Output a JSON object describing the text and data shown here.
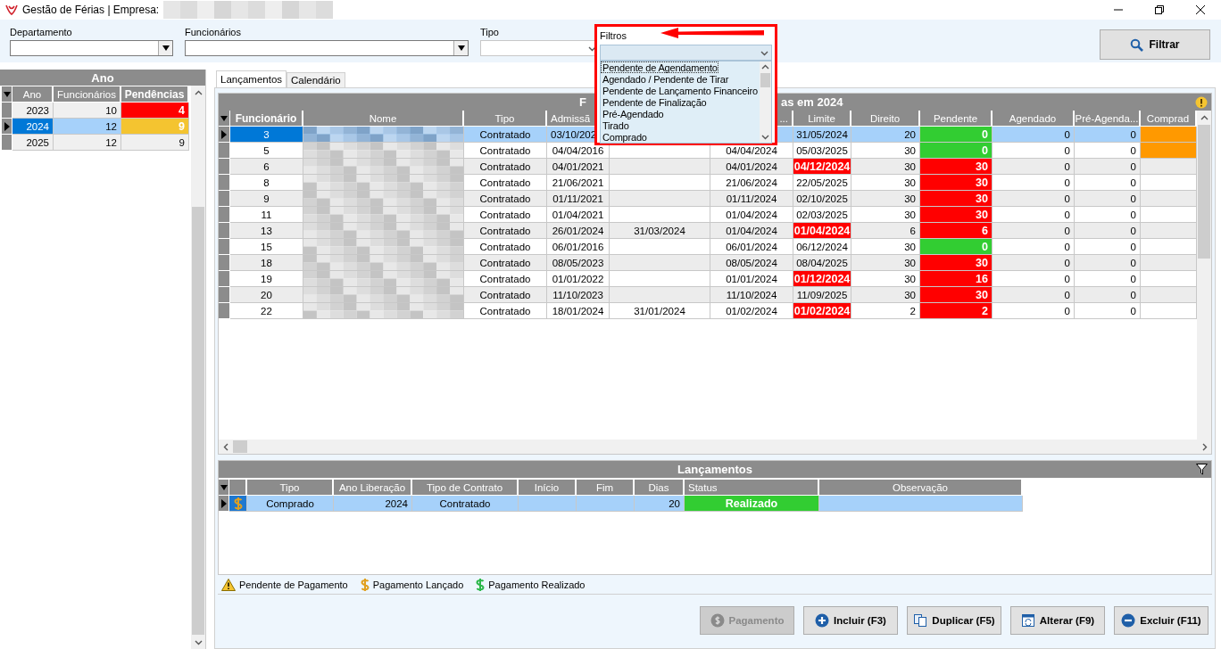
{
  "window": {
    "title": "Gestão de Férias | Empresa:"
  },
  "filters": [
    {
      "label": "Departamento",
      "kind": "combo",
      "disabled": false
    },
    {
      "label": "Funcionários",
      "kind": "combo",
      "disabled": false
    },
    {
      "label": "Tipo",
      "kind": "combo",
      "disabled": true
    }
  ],
  "filter_dropdown": {
    "label": "Filtros",
    "options": [
      {
        "label": "Pendente de Agendamento",
        "selected": true
      },
      {
        "label": "Agendado / Pendente de Tirar",
        "selected": false
      },
      {
        "label": "Pendente de Lançamento Financeiro",
        "selected": false
      },
      {
        "label": "Pendente de Finalização",
        "selected": false
      },
      {
        "label": "Pré-Agendado",
        "selected": false
      },
      {
        "label": "Tirado",
        "selected": false
      },
      {
        "label": "Comprado",
        "selected": false
      }
    ]
  },
  "filter_button": "Filtrar",
  "year_panel": {
    "title": "Ano",
    "columns": [
      "Ano",
      "Funcionários",
      "Pendências"
    ],
    "rows": [
      {
        "ano": "2023",
        "funcionarios": "10",
        "pendencias": "4",
        "color": "#ff0000",
        "selected": false
      },
      {
        "ano": "2024",
        "funcionarios": "12",
        "pendencias": "9",
        "color": "#f4c430",
        "selected": true
      },
      {
        "ano": "2025",
        "funcionarios": "12",
        "pendencias": "9",
        "selected": false
      }
    ]
  },
  "tabs": [
    {
      "label": "Lançamentos",
      "selected": true
    },
    {
      "label": "Calendário",
      "selected": false
    }
  ],
  "employees_grid": {
    "title_start": "F",
    "title_end": "as em 2024",
    "columns": [
      "Funcionário",
      "Nome",
      "Tipo",
      "Admissã",
      "...",
      "Limite",
      "Direito",
      "Pendente",
      "Agendado",
      "Pré-Agenda...",
      "Comprad"
    ],
    "rows": [
      {
        "funcionario": "3",
        "tipo": "Contratado",
        "admissao": "03/10/202",
        "limite": "31/05/2024",
        "limite_late": false,
        "direito": "20",
        "pendente": "0",
        "pendente_late": false,
        "agendado": "0",
        "pre_agendado": "0",
        "comprado_marked": true,
        "selected": true
      },
      {
        "funcionario": "5",
        "tipo": "Contratado",
        "admissao": "04/04/2016",
        "column_7": "04/04/2024",
        "limite": "05/03/2025",
        "limite_late": false,
        "direito": "30",
        "pendente": "0",
        "pendente_late": false,
        "agendado": "0",
        "pre_agendado": "0",
        "comprado_marked": true,
        "selected": false
      },
      {
        "funcionario": "6",
        "tipo": "Contratado",
        "admissao": "04/01/2021",
        "column_7": "04/01/2024",
        "limite": "04/12/2024",
        "limite_late": true,
        "direito": "30",
        "pendente": "30",
        "pendente_late": true,
        "agendado": "0",
        "pre_agendado": "0",
        "comprado_marked": false,
        "selected": false
      },
      {
        "funcionario": "8",
        "tipo": "Contratado",
        "admissao": "21/06/2021",
        "column_7": "21/06/2024",
        "limite": "22/05/2025",
        "limite_late": false,
        "direito": "30",
        "pendente": "30",
        "pendente_late": true,
        "agendado": "0",
        "pre_agendado": "0",
        "comprado_marked": false,
        "selected": false
      },
      {
        "funcionario": "9",
        "tipo": "Contratado",
        "admissao": "01/11/2021",
        "column_7": "01/11/2024",
        "limite": "02/10/2025",
        "limite_late": false,
        "direito": "30",
        "pendente": "30",
        "pendente_late": true,
        "agendado": "0",
        "pre_agendado": "0",
        "comprado_marked": false,
        "selected": false
      },
      {
        "funcionario": "11",
        "tipo": "Contratado",
        "admissao": "01/04/2021",
        "column_7": "01/04/2024",
        "limite": "02/03/2025",
        "limite_late": false,
        "direito": "30",
        "pendente": "30",
        "pendente_late": true,
        "agendado": "0",
        "pre_agendado": "0",
        "comprado_marked": false,
        "selected": false
      },
      {
        "funcionario": "13",
        "tipo": "Contratado",
        "admissao": "26/01/2024",
        "column_6": "31/03/2024",
        "column_7": "01/04/2024",
        "limite": "01/04/2024",
        "limite_late": true,
        "direito": "6",
        "pendente": "6",
        "pendente_late": true,
        "agendado": "0",
        "pre_agendado": "0",
        "comprado_marked": false,
        "selected": false
      },
      {
        "funcionario": "15",
        "tipo": "Contratado",
        "admissao": "06/01/2016",
        "column_7": "06/01/2024",
        "limite": "06/12/2024",
        "limite_late": false,
        "direito": "30",
        "pendente": "0",
        "pendente_late": false,
        "agendado": "0",
        "pre_agendado": "0",
        "comprado_marked": false,
        "selected": false
      },
      {
        "funcionario": "18",
        "tipo": "Contratado",
        "admissao": "08/05/2023",
        "column_7": "08/05/2024",
        "limite": "08/04/2025",
        "limite_late": false,
        "direito": "30",
        "pendente": "30",
        "pendente_late": true,
        "agendado": "0",
        "pre_agendado": "0",
        "comprado_marked": false,
        "selected": false
      },
      {
        "funcionario": "19",
        "tipo": "Contratado",
        "admissao": "01/01/2022",
        "column_7": "01/01/2024",
        "limite": "01/12/2024",
        "limite_late": true,
        "direito": "30",
        "pendente": "16",
        "pendente_late": true,
        "agendado": "0",
        "pre_agendado": "0",
        "comprado_marked": false,
        "selected": false
      },
      {
        "funcionario": "20",
        "tipo": "Contratado",
        "admissao": "11/10/2023",
        "column_7": "11/10/2024",
        "limite": "11/09/2025",
        "limite_late": false,
        "direito": "30",
        "pendente": "30",
        "pendente_late": true,
        "agendado": "0",
        "pre_agendado": "0",
        "comprado_marked": false,
        "selected": false
      },
      {
        "funcionario": "22",
        "tipo": "Contratado",
        "admissao": "18/01/2024",
        "column_6": "31/01/2024",
        "column_7": "01/02/2024",
        "limite": "01/02/2024",
        "limite_late": true,
        "direito": "2",
        "pendente": "2",
        "pendente_late": true,
        "agendado": "0",
        "pre_agendado": "0",
        "comprado_marked": false,
        "selected": false
      }
    ]
  },
  "entries_grid": {
    "title": "Lançamentos",
    "columns": [
      "Tipo",
      "Ano Liberação",
      "Tipo de Contrato",
      "Início",
      "Fim",
      "Dias",
      "Status",
      "Observação"
    ],
    "rows": [
      {
        "tipo": "Comprado",
        "ano_liberacao": "2024",
        "tipo_contrato": "Contratado",
        "dias": "20",
        "status": "Realizado",
        "selected": true
      }
    ]
  },
  "legend": [
    {
      "kind": "warning",
      "label": "Pendente de Pagamento"
    },
    {
      "kind": "launched",
      "label": "Pagamento Lançado"
    },
    {
      "kind": "done",
      "label": "Pagamento Realizado"
    }
  ],
  "buttons": [
    {
      "kind": "payment",
      "label": "Pagamento",
      "disabled": true
    },
    {
      "kind": "add",
      "label": "Incluir (F3)",
      "disabled": false
    },
    {
      "kind": "duplicate",
      "label": "Duplicar (F5)",
      "disabled": false
    },
    {
      "kind": "edit",
      "label": "Alterar (F9)",
      "disabled": false
    },
    {
      "kind": "delete",
      "label": "Excluir (F11)",
      "disabled": false
    }
  ]
}
